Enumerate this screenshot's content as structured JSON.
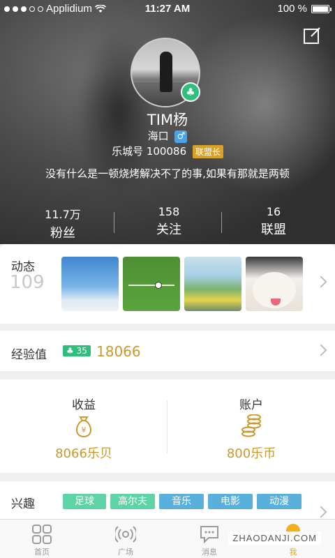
{
  "status_bar": {
    "carrier": "Applidium",
    "time": "11:27 AM",
    "battery": "100 %"
  },
  "profile": {
    "name": "TIM杨",
    "location": "海口",
    "gender_symbol": "♂",
    "id_label": "乐城号 100086",
    "role": "联盟长",
    "signature": "没有什么是一顿烧烤解决不了的事,如果有那就是两顿",
    "badge_icon": "club-icon"
  },
  "stats": [
    {
      "value": "11.7万",
      "label": "粉丝"
    },
    {
      "value": "158",
      "label": "关注"
    },
    {
      "value": "16",
      "label": "联盟"
    }
  ],
  "moments": {
    "title": "动态",
    "count": "109"
  },
  "experience": {
    "title": "经验值",
    "level": "35",
    "value": "18066"
  },
  "earnings": {
    "income": {
      "label": "收益",
      "amount": "8066乐贝",
      "icon": "money-bag-icon"
    },
    "account": {
      "label": "账户",
      "amount": "800乐币",
      "icon": "coins-icon"
    }
  },
  "interests": {
    "title": "兴趣",
    "tags": [
      "足球",
      "高尔夫",
      "音乐",
      "电影",
      "动漫"
    ]
  },
  "tabbar": [
    {
      "label": "首页",
      "icon": "grid-icon"
    },
    {
      "label": "广场",
      "icon": "broadcast-icon"
    },
    {
      "label": "消息",
      "icon": "chat-icon"
    },
    {
      "label": "我",
      "icon": "me-icon"
    }
  ],
  "watermark": "ZHAODANJI.COM",
  "colors": {
    "gold": "#c9992c",
    "green": "#2fbf7a",
    "blue": "#59b0dc",
    "tab_active": "#e6a817"
  }
}
